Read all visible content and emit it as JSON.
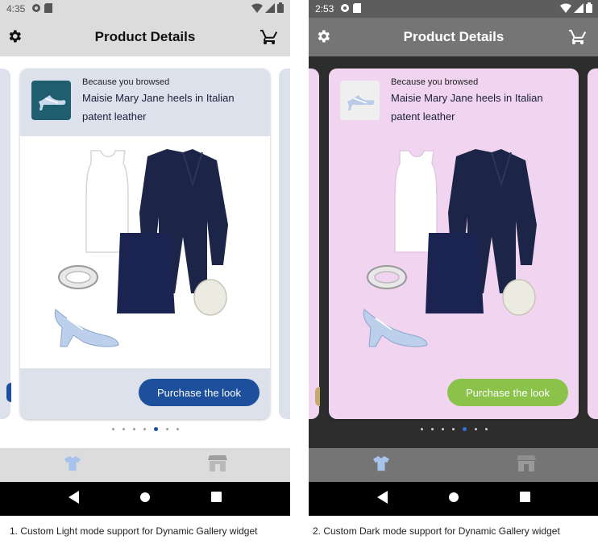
{
  "colors": {
    "light_accent": "#1c4f9c",
    "dark_accent": "#8bc34a",
    "light_card": "#dce1eb",
    "dark_card": "#f0d4f0",
    "dark_background": "#2d2d2d"
  },
  "screens": [
    {
      "mode": "light",
      "status_time": "4:35",
      "app_title": "Product Details",
      "card": {
        "eyebrow": "Because you browsed",
        "product_title": "Maisie Mary Jane heels in Italian patent leather",
        "button_label": "Purchase the look"
      },
      "pagination": {
        "count": 7,
        "active_index": 4
      },
      "bottom_nav": [
        "shirt-icon",
        "store-icon"
      ]
    },
    {
      "mode": "dark",
      "status_time": "2:53",
      "app_title": "Product Details",
      "card": {
        "eyebrow": "Because you browsed",
        "product_title": "Maisie Mary Jane heels in Italian patent leather",
        "button_label": "Purchase the look"
      },
      "pagination": {
        "count": 7,
        "active_index": 4
      },
      "bottom_nav": [
        "shirt-icon",
        "store-icon"
      ]
    }
  ],
  "captions": [
    "1. Custom Light mode support for Dynamic Gallery widget",
    "2. Custom Dark mode support for Dynamic Gallery widget"
  ]
}
